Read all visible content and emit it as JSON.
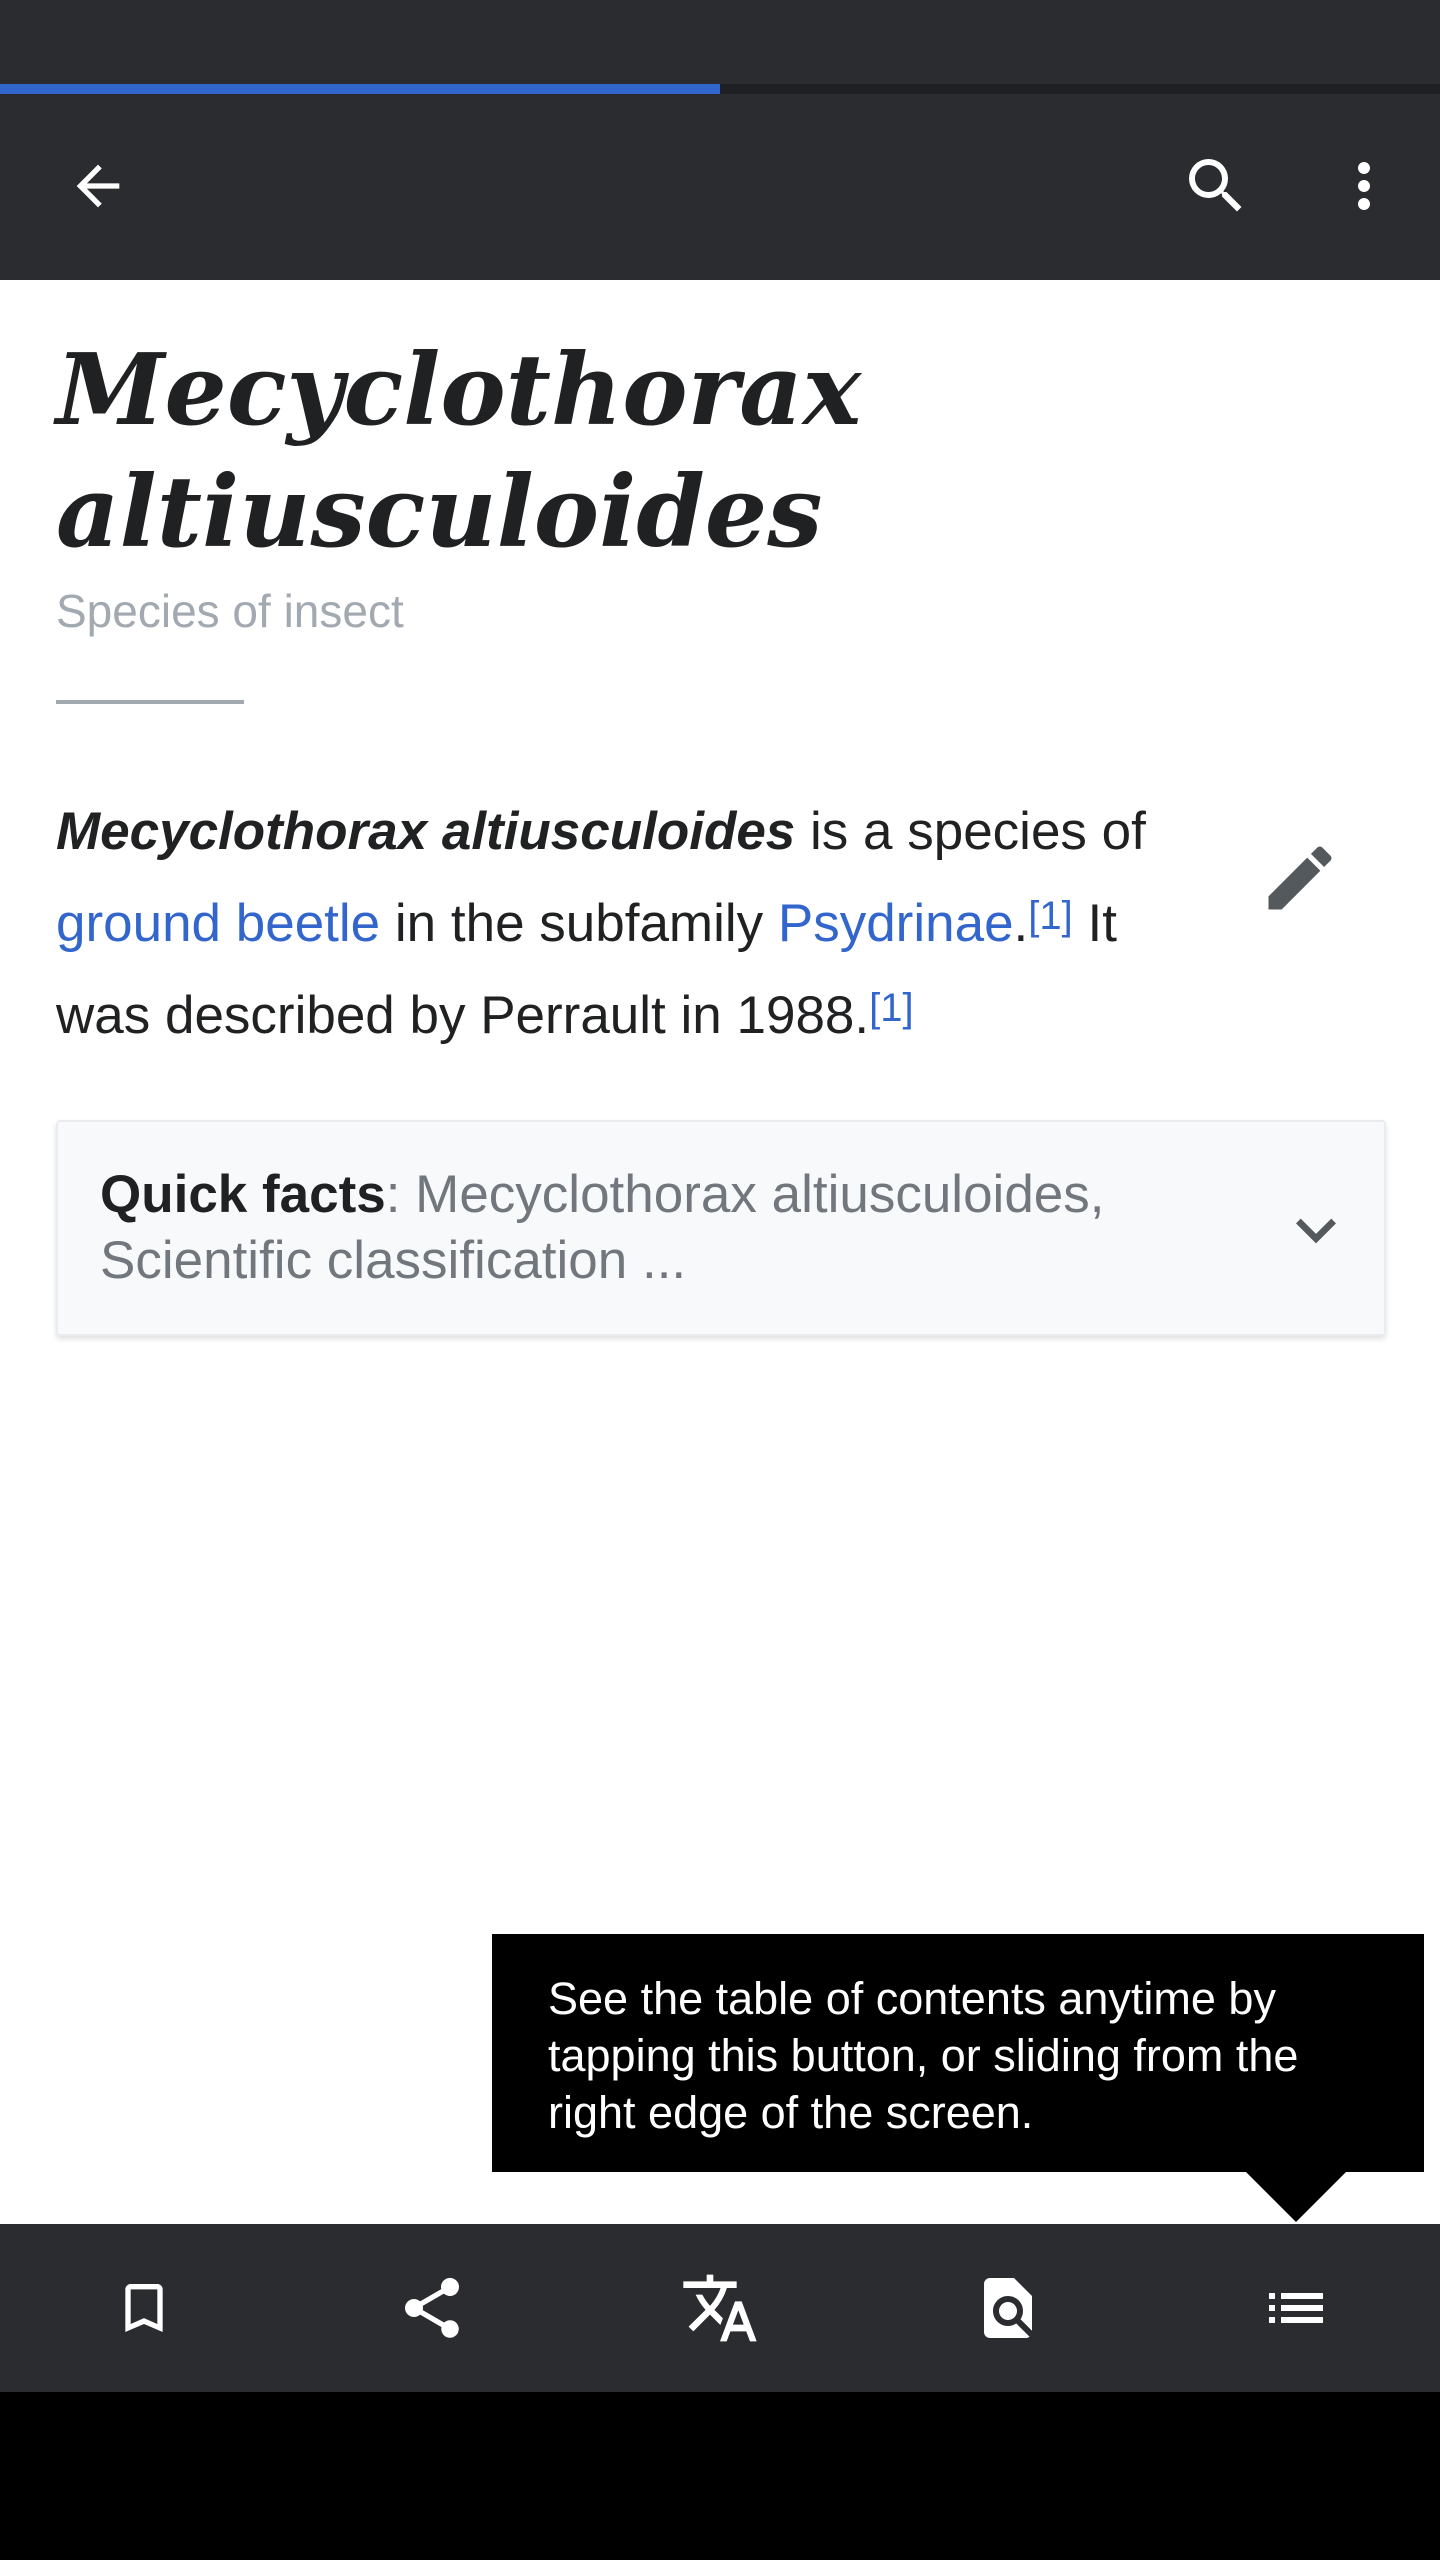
{
  "toolbar": {
    "back_icon": "arrow-back-icon",
    "search_icon": "search-icon",
    "more_icon": "more-vertical-icon"
  },
  "load_progress": 0.5,
  "colors": {
    "accent": "#3366cc",
    "toolbar_bg": "#2b2c2f",
    "text": "#202122",
    "muted": "#a2a9b1"
  },
  "article": {
    "title": "Mecyclothorax altiusculoides",
    "description": "Species of insect",
    "lead": {
      "bold_name": "Mecyclothorax altiusculoides",
      "text_1": " is a species of ",
      "link_1": "ground beetle",
      "text_2": " in the subfamily ",
      "link_2": "Psydrinae",
      "text_3": ".",
      "ref_1": "[1]",
      "text_4": " It was described by Perrault in 1988.",
      "ref_2": "[1]"
    },
    "edit_icon": "pencil-icon"
  },
  "quick_facts": {
    "label": "Quick facts",
    "summary": ": Mecyclothorax altiusculoides, Scientific classification ...",
    "chevron_icon": "chevron-down-icon"
  },
  "tooltip": {
    "text": "See the table of contents anytime by tapping this button, or sliding from the right edge of the screen."
  },
  "bottom_bar": {
    "items": [
      {
        "icon": "bookmark-icon"
      },
      {
        "icon": "share-icon"
      },
      {
        "icon": "translate-icon"
      },
      {
        "icon": "find-in-page-icon"
      },
      {
        "icon": "table-of-contents-icon"
      }
    ]
  }
}
